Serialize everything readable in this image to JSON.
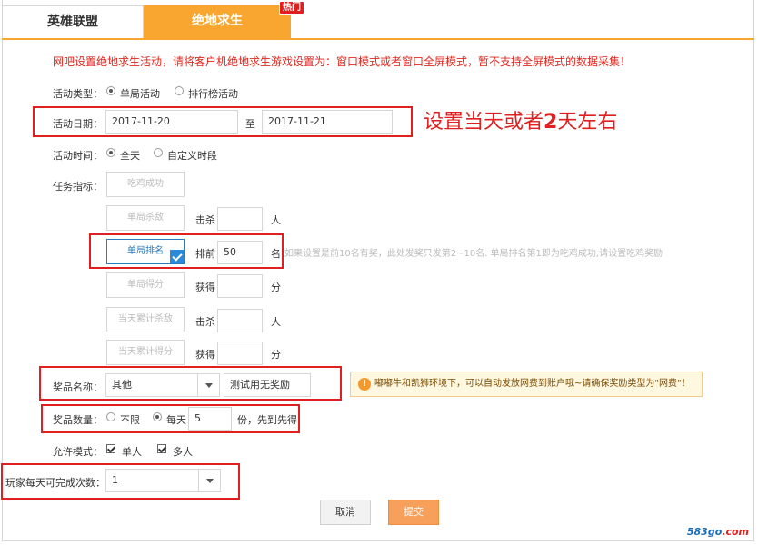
{
  "tabs": [
    {
      "label": "英雄联盟",
      "active": false
    },
    {
      "label": "绝地求生",
      "active": true
    }
  ],
  "hot_badge": "热门",
  "notice": "网吧设置绝地求生活动，请将客户机绝地求生游戏设置为：窗口模式或者窗口全屏模式，暂不支持全屏模式的数据采集！",
  "activity_type": {
    "label": "活动类型：",
    "options": [
      "单局活动",
      "排行榜活动"
    ],
    "selected": "单局活动"
  },
  "activity_date": {
    "label": "活动日期：",
    "start": "2017-11-20",
    "to": "至",
    "end": "2017-11-21"
  },
  "annotation": {
    "prefix": "设置当天或者",
    "bold": "2",
    "suffix": "天左右"
  },
  "activity_time": {
    "label": "活动时间：",
    "options": [
      "全天",
      "自定义时段"
    ],
    "selected": "全天"
  },
  "task": {
    "label": "任务指标：",
    "items": [
      {
        "name": "吃鸡成功",
        "selected": false,
        "prefix": "",
        "value": "",
        "suffix": ""
      },
      {
        "name": "单局杀敌",
        "selected": false,
        "prefix": "击杀",
        "value": "",
        "suffix": "人"
      },
      {
        "name": "单局排名",
        "selected": true,
        "prefix": "排前",
        "value": "50",
        "suffix": "名"
      },
      {
        "name": "单局得分",
        "selected": false,
        "prefix": "获得",
        "value": "",
        "suffix": "分"
      },
      {
        "name": "当天累计杀敌",
        "selected": false,
        "prefix": "击杀",
        "value": "",
        "suffix": "人"
      },
      {
        "name": "当天累计得分",
        "selected": false,
        "prefix": "获得",
        "value": "",
        "suffix": "分"
      }
    ],
    "rank_hint": "如果设置是前10名有奖，此处发奖只发第2~10名. 单局排名第1即为吃鸡成功,请设置吃鸡奖励"
  },
  "prize_name": {
    "label": "奖品名称：",
    "type_value": "其他",
    "name_value": "测试用无奖励"
  },
  "warning": "嘟嘟牛和凯狮环境下，可以自动发放网费到账户哦~请确保奖励类型为\"网费\"！",
  "prize_count": {
    "label": "奖品数量：",
    "options": [
      "不限",
      "每天"
    ],
    "selected": "每天",
    "value": "5",
    "suffix": "份，先到先得"
  },
  "allow_mode": {
    "label": "允许模式：",
    "options": [
      "单人",
      "多人"
    ],
    "checked": [
      "单人",
      "多人"
    ]
  },
  "daily_limit": {
    "label": "玩家每天可完成次数：",
    "value": "1"
  },
  "buttons": {
    "cancel": "取消",
    "submit": "提交"
  },
  "watermark": {
    "main": "583go",
    "suffix": ".com"
  },
  "colors": {
    "accent": "#f8a630",
    "alert": "#e02020",
    "link": "#2b7bc3"
  }
}
